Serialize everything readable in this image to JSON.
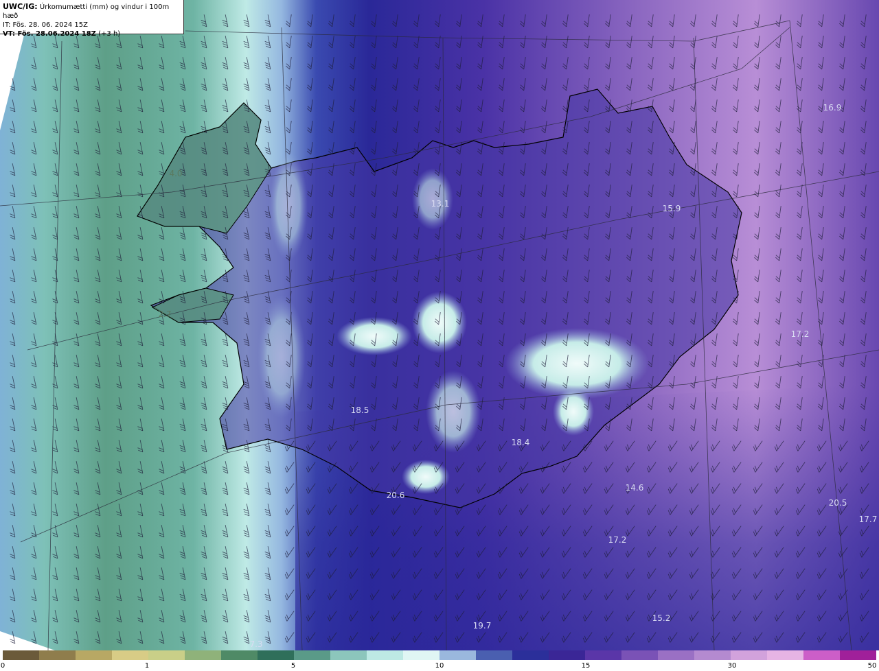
{
  "title": {
    "prefix": "UWC/IG:",
    "main": "Úrkomumætti (mm) og vindur i 100m hæð",
    "it_line": "IT: Fös. 28. 06. 2024 15Z",
    "vt_prefix": "VT: Fös. 28.06.2024 18Z",
    "vt_suffix": "(+3 h)"
  },
  "map_values": [
    {
      "text": "4.0",
      "style": "dark"
    },
    {
      "text": "2.7",
      "style": "dark"
    },
    {
      "text": "13.1",
      "style": "light"
    },
    {
      "text": "15.9",
      "style": "light"
    },
    {
      "text": "16.9",
      "style": "light"
    },
    {
      "text": "17.2",
      "style": "light"
    },
    {
      "text": "18.5",
      "style": "light"
    },
    {
      "text": "18.4",
      "style": "light"
    },
    {
      "text": "20.6",
      "style": "light"
    },
    {
      "text": "14.6",
      "style": "light"
    },
    {
      "text": "20.5",
      "style": "light"
    },
    {
      "text": "17.7",
      "style": "light"
    },
    {
      "text": "17.2",
      "style": "light"
    },
    {
      "text": "19.7",
      "style": "light"
    },
    {
      "text": "15.2",
      "style": "light"
    },
    {
      "text": "7.3",
      "style": "light"
    }
  ],
  "colorbar": {
    "ticks": [
      "0",
      "1",
      "5",
      "10",
      "15",
      "30",
      "50"
    ],
    "colors": [
      "#6b5a3a",
      "#8f7d4c",
      "#b8a864",
      "#d8cc86",
      "#c9cf88",
      "#8fb27a",
      "#4f8a66",
      "#2f6f5a",
      "#5a9a88",
      "#8cc6bc",
      "#bde9e4",
      "#e0f6f4",
      "#9ab8dd",
      "#4a5fb0",
      "#2b2f9a",
      "#3a2696",
      "#5a36a8",
      "#7a52b6",
      "#9a70c4",
      "#b48ad0",
      "#d2a2dc",
      "#e6b4e4",
      "#cc5ec8",
      "#a0209a"
    ]
  },
  "palette": {
    "sea_teal": "#8ccfc6",
    "sea_green": "#5f9e86",
    "deep_blue": "#2a2a9a",
    "purple": "#6a4bb4",
    "light_purple": "#b88fd4",
    "cloud_white": "#e8f6f4",
    "barb_color": "#1e1e3a",
    "coast_color": "#000000"
  }
}
